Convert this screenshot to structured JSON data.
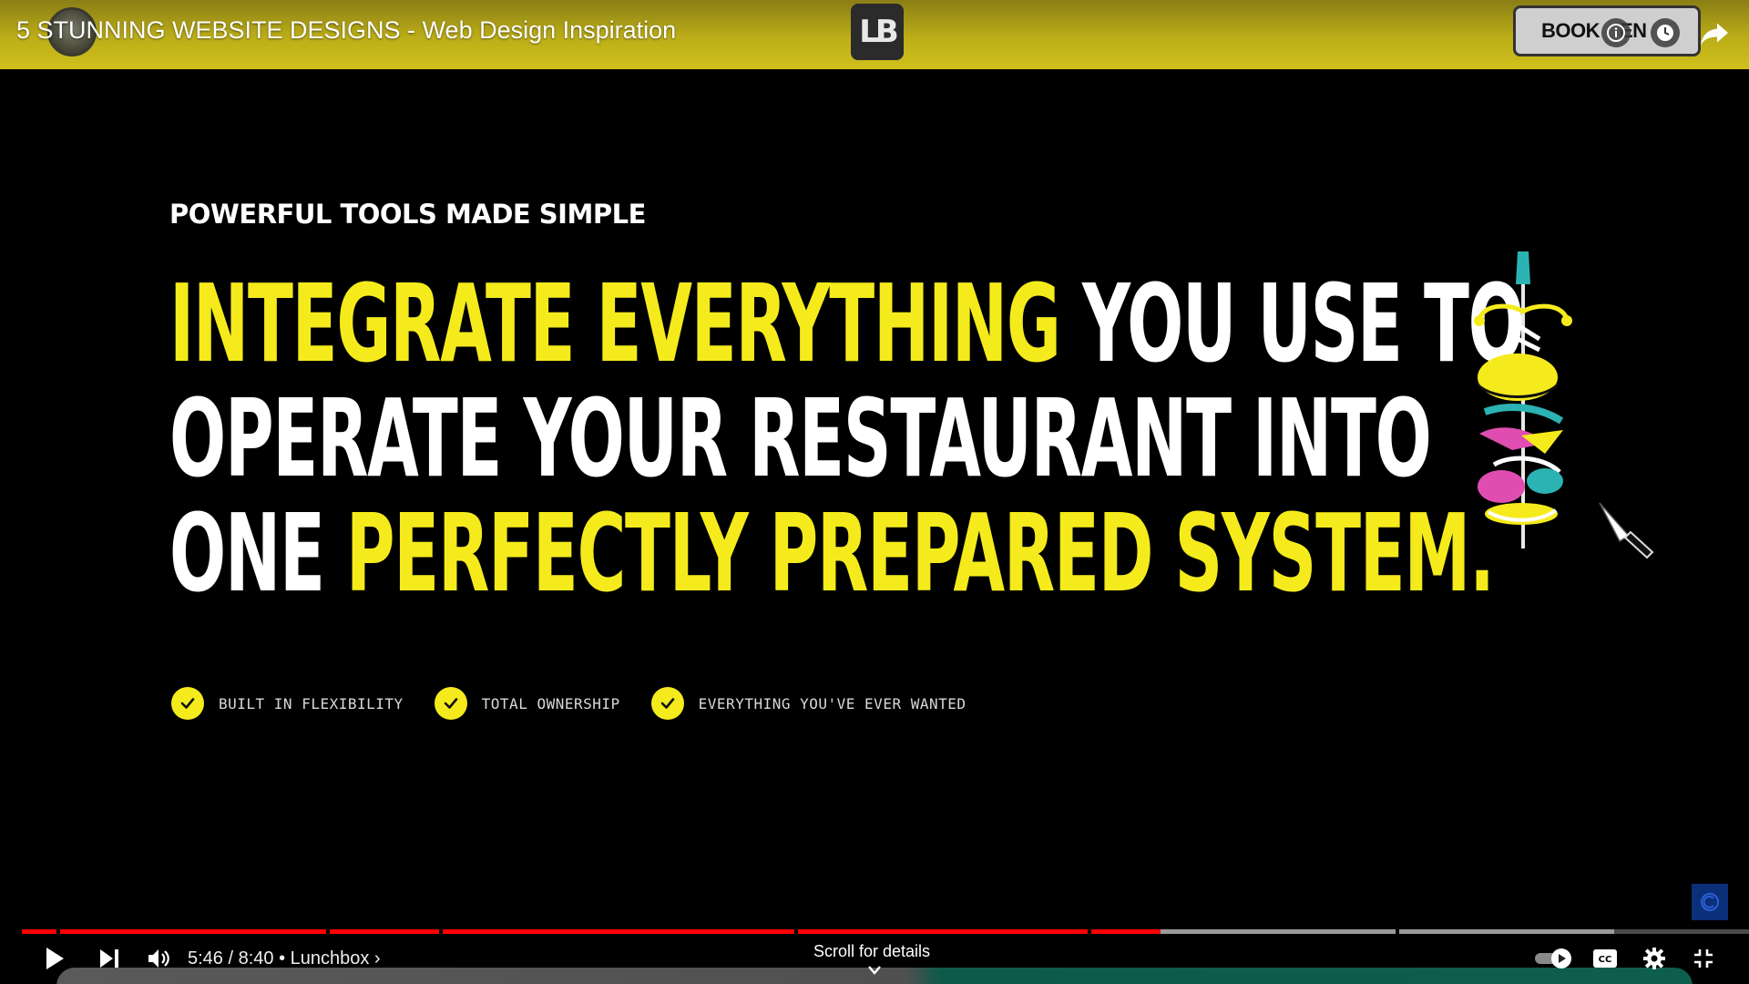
{
  "header": {
    "title": "5 STUNNING WEBSITE DESIGNS - Web Design Inspiration",
    "logo_text": "LB",
    "book_button_label": "BOOK",
    "book_button_suffix": "EN"
  },
  "slide": {
    "kicker": "POWERFUL TOOLS MADE SIMPLE",
    "headline_lines": [
      [
        {
          "text": "INTEGRATE EVERYTHING ",
          "highlight": true
        },
        {
          "text": "YOU USE TO",
          "highlight": false
        }
      ],
      [
        {
          "text": "OPERATE YOUR RESTAURANT INTO",
          "highlight": false
        }
      ],
      [
        {
          "text": "ONE ",
          "highlight": false
        },
        {
          "text": "PERFECTLY PREPARED SYSTEM.",
          "highlight": true
        }
      ]
    ],
    "features": [
      "BUILT IN FLEXIBILITY",
      "TOTAL OWNERSHIP",
      "EVERYTHING YOU'VE EVER WANTED"
    ]
  },
  "player": {
    "current_time": "5:46",
    "duration": "8:40",
    "chapter": "Lunchbox",
    "time_display": "5:46 / 8:40 • Lunchbox ›",
    "scroll_hint": "Scroll for details",
    "progress_fraction": 0.665
  },
  "colors": {
    "accent_yellow": "#f5eb1c",
    "progress_played": "#ff0000",
    "progress_buffered": "#9a9a9a",
    "progress_unplayed": "#4a4a4a"
  }
}
